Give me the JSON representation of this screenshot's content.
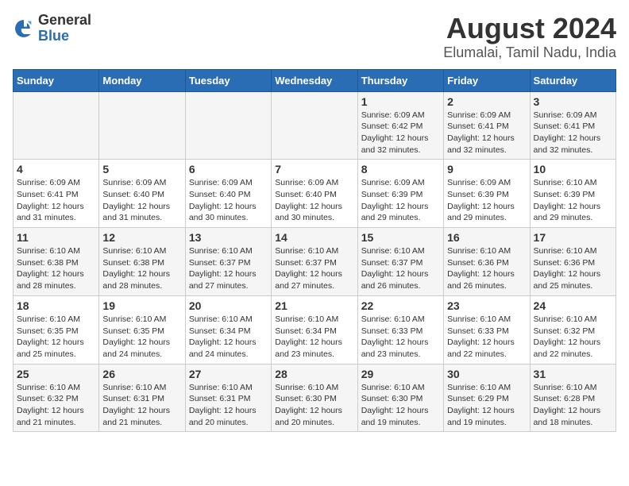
{
  "header": {
    "logo": {
      "line1": "General",
      "line2": "Blue"
    },
    "title": "August 2024",
    "subtitle": "Elumalai, Tamil Nadu, India"
  },
  "weekdays": [
    "Sunday",
    "Monday",
    "Tuesday",
    "Wednesday",
    "Thursday",
    "Friday",
    "Saturday"
  ],
  "weeks": [
    [
      {
        "day": "",
        "info": ""
      },
      {
        "day": "",
        "info": ""
      },
      {
        "day": "",
        "info": ""
      },
      {
        "day": "",
        "info": ""
      },
      {
        "day": "1",
        "info": "Sunrise: 6:09 AM\nSunset: 6:42 PM\nDaylight: 12 hours\nand 32 minutes."
      },
      {
        "day": "2",
        "info": "Sunrise: 6:09 AM\nSunset: 6:41 PM\nDaylight: 12 hours\nand 32 minutes."
      },
      {
        "day": "3",
        "info": "Sunrise: 6:09 AM\nSunset: 6:41 PM\nDaylight: 12 hours\nand 32 minutes."
      }
    ],
    [
      {
        "day": "4",
        "info": "Sunrise: 6:09 AM\nSunset: 6:41 PM\nDaylight: 12 hours\nand 31 minutes."
      },
      {
        "day": "5",
        "info": "Sunrise: 6:09 AM\nSunset: 6:40 PM\nDaylight: 12 hours\nand 31 minutes."
      },
      {
        "day": "6",
        "info": "Sunrise: 6:09 AM\nSunset: 6:40 PM\nDaylight: 12 hours\nand 30 minutes."
      },
      {
        "day": "7",
        "info": "Sunrise: 6:09 AM\nSunset: 6:40 PM\nDaylight: 12 hours\nand 30 minutes."
      },
      {
        "day": "8",
        "info": "Sunrise: 6:09 AM\nSunset: 6:39 PM\nDaylight: 12 hours\nand 29 minutes."
      },
      {
        "day": "9",
        "info": "Sunrise: 6:09 AM\nSunset: 6:39 PM\nDaylight: 12 hours\nand 29 minutes."
      },
      {
        "day": "10",
        "info": "Sunrise: 6:10 AM\nSunset: 6:39 PM\nDaylight: 12 hours\nand 29 minutes."
      }
    ],
    [
      {
        "day": "11",
        "info": "Sunrise: 6:10 AM\nSunset: 6:38 PM\nDaylight: 12 hours\nand 28 minutes."
      },
      {
        "day": "12",
        "info": "Sunrise: 6:10 AM\nSunset: 6:38 PM\nDaylight: 12 hours\nand 28 minutes."
      },
      {
        "day": "13",
        "info": "Sunrise: 6:10 AM\nSunset: 6:37 PM\nDaylight: 12 hours\nand 27 minutes."
      },
      {
        "day": "14",
        "info": "Sunrise: 6:10 AM\nSunset: 6:37 PM\nDaylight: 12 hours\nand 27 minutes."
      },
      {
        "day": "15",
        "info": "Sunrise: 6:10 AM\nSunset: 6:37 PM\nDaylight: 12 hours\nand 26 minutes."
      },
      {
        "day": "16",
        "info": "Sunrise: 6:10 AM\nSunset: 6:36 PM\nDaylight: 12 hours\nand 26 minutes."
      },
      {
        "day": "17",
        "info": "Sunrise: 6:10 AM\nSunset: 6:36 PM\nDaylight: 12 hours\nand 25 minutes."
      }
    ],
    [
      {
        "day": "18",
        "info": "Sunrise: 6:10 AM\nSunset: 6:35 PM\nDaylight: 12 hours\nand 25 minutes."
      },
      {
        "day": "19",
        "info": "Sunrise: 6:10 AM\nSunset: 6:35 PM\nDaylight: 12 hours\nand 24 minutes."
      },
      {
        "day": "20",
        "info": "Sunrise: 6:10 AM\nSunset: 6:34 PM\nDaylight: 12 hours\nand 24 minutes."
      },
      {
        "day": "21",
        "info": "Sunrise: 6:10 AM\nSunset: 6:34 PM\nDaylight: 12 hours\nand 23 minutes."
      },
      {
        "day": "22",
        "info": "Sunrise: 6:10 AM\nSunset: 6:33 PM\nDaylight: 12 hours\nand 23 minutes."
      },
      {
        "day": "23",
        "info": "Sunrise: 6:10 AM\nSunset: 6:33 PM\nDaylight: 12 hours\nand 22 minutes."
      },
      {
        "day": "24",
        "info": "Sunrise: 6:10 AM\nSunset: 6:32 PM\nDaylight: 12 hours\nand 22 minutes."
      }
    ],
    [
      {
        "day": "25",
        "info": "Sunrise: 6:10 AM\nSunset: 6:32 PM\nDaylight: 12 hours\nand 21 minutes."
      },
      {
        "day": "26",
        "info": "Sunrise: 6:10 AM\nSunset: 6:31 PM\nDaylight: 12 hours\nand 21 minutes."
      },
      {
        "day": "27",
        "info": "Sunrise: 6:10 AM\nSunset: 6:31 PM\nDaylight: 12 hours\nand 20 minutes."
      },
      {
        "day": "28",
        "info": "Sunrise: 6:10 AM\nSunset: 6:30 PM\nDaylight: 12 hours\nand 20 minutes."
      },
      {
        "day": "29",
        "info": "Sunrise: 6:10 AM\nSunset: 6:30 PM\nDaylight: 12 hours\nand 19 minutes."
      },
      {
        "day": "30",
        "info": "Sunrise: 6:10 AM\nSunset: 6:29 PM\nDaylight: 12 hours\nand 19 minutes."
      },
      {
        "day": "31",
        "info": "Sunrise: 6:10 AM\nSunset: 6:28 PM\nDaylight: 12 hours\nand 18 minutes."
      }
    ]
  ]
}
